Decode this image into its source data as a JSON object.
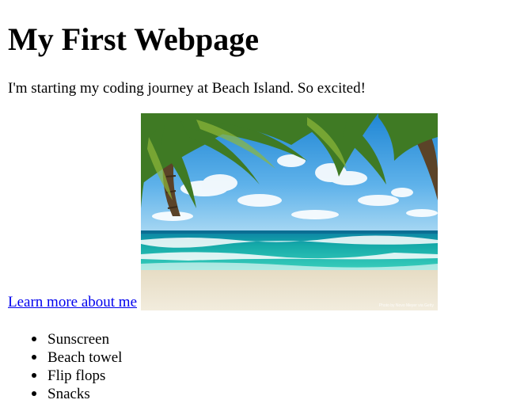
{
  "heading": "My First Webpage",
  "intro": "I'm starting my coding journey at Beach Island. So excited!",
  "link": {
    "label": "Learn more about me"
  },
  "image": {
    "alt": "Tropical beach with palm trees",
    "credit": "Photo by Novo Meyer via Getty"
  },
  "list": {
    "items": [
      "Sunscreen",
      "Beach towel",
      "Flip flops",
      "Snacks"
    ]
  },
  "colors": {
    "link": "#0000ee",
    "text": "#000000",
    "background": "#ffffff"
  }
}
